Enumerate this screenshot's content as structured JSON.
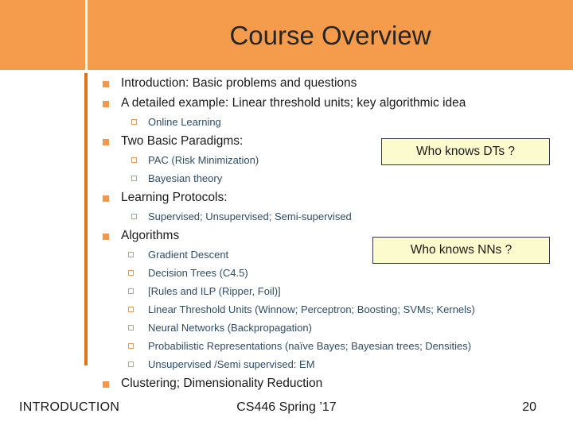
{
  "theme": {
    "header_band_color": "#F59B4C",
    "accent_bar_color": "#DD7518",
    "level1_marker_color": "#F2974B",
    "level2_marker_color": "#E9964A",
    "level1_text_color": "#1A1A1A",
    "level2_text_color": "#2E4C66",
    "callout_fill_color": "#FCFBCD",
    "callout_border_color": "#2B3A47",
    "title_color": "#262626",
    "background_color": "#FFFFFF"
  },
  "header": {
    "title": "Course Overview"
  },
  "outline": [
    {
      "level": 1,
      "text": "Introduction: Basic problems and questions"
    },
    {
      "level": 1,
      "text": "A detailed example: Linear threshold units; key algorithmic idea"
    },
    {
      "level": 2,
      "text": "Online Learning"
    },
    {
      "level": 1,
      "text": "Two Basic Paradigms:"
    },
    {
      "level": 2,
      "text": "PAC (Risk Minimization)"
    },
    {
      "level": 2,
      "text": "Bayesian theory"
    },
    {
      "level": 1,
      "text": "Learning Protocols:"
    },
    {
      "level": 2,
      "text": "Supervised; Unsupervised; Semi-supervised"
    },
    {
      "level": 1,
      "text": "Algorithms"
    },
    {
      "level": 2,
      "text": "Gradient Descent",
      "deep": true
    },
    {
      "level": 2,
      "text": "Decision Trees (C4.5)",
      "deep": true
    },
    {
      "level": 2,
      "text": "[Rules and ILP (Ripper, Foil)]",
      "deep": true
    },
    {
      "level": 2,
      "text": "Linear Threshold Units (Winnow; Perceptron; Boosting; SVMs; Kernels)",
      "deep": true
    },
    {
      "level": 2,
      "text": "Neural Networks (Backpropagation)",
      "deep": true
    },
    {
      "level": 2,
      "text": "Probabilistic Representations (naïve Bayes;  Bayesian trees;  Densities)",
      "deep": true
    },
    {
      "level": 2,
      "text": "Unsupervised /Semi supervised: EM",
      "deep": true
    },
    {
      "level": 1,
      "text": "Clustering; Dimensionality Reduction"
    }
  ],
  "callouts": {
    "dts": "Who knows DTs ?",
    "nns": "Who knows NNs ?"
  },
  "footer": {
    "left": "INTRODUCTION",
    "center": "CS446 Spring ’17",
    "right": "20"
  }
}
